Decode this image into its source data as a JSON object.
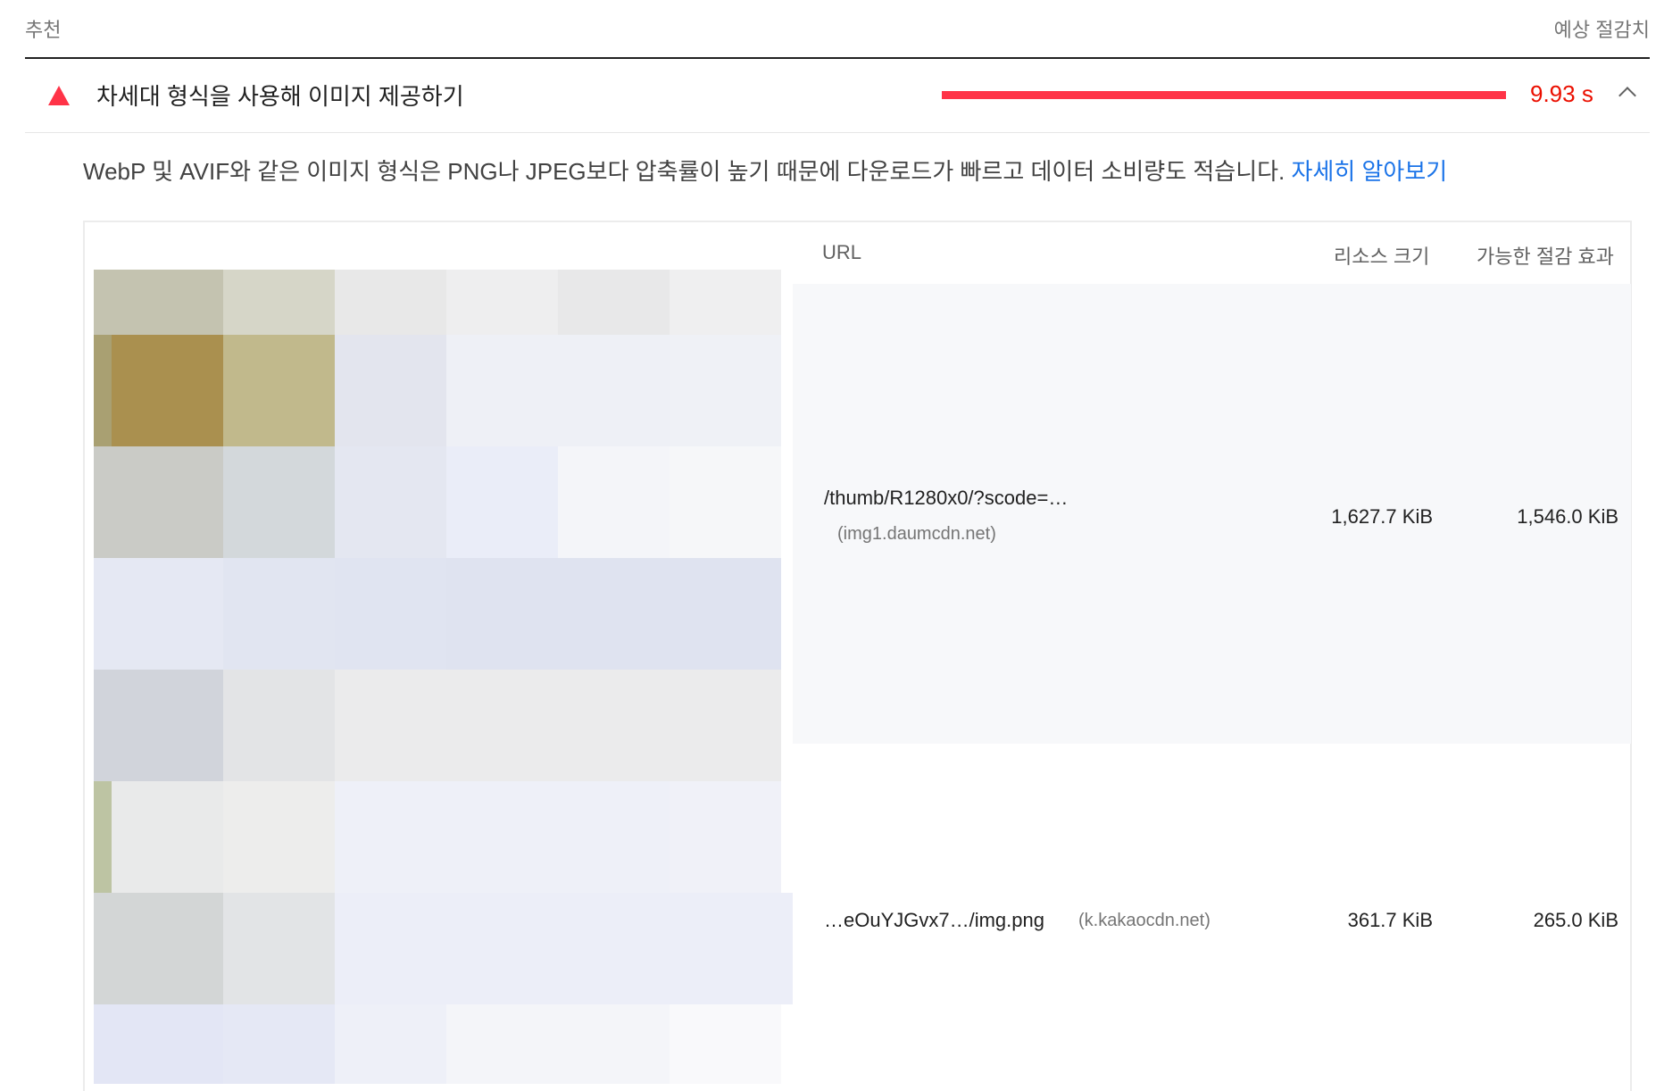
{
  "group": {
    "label": "추천",
    "savings_label": "예상 절감치"
  },
  "audit": {
    "title": "차세대 형식을 사용해 이미지 제공하기",
    "savings": "9.93 s",
    "status_color": "#ff3347",
    "icon": "warning-triangle-icon",
    "expanded": true
  },
  "description": {
    "text": "WebP 및 AVIF와 같은 이미지 형식은 PNG나 JPEG보다 압축률이 높기 때문에 다운로드가 빠르고 데이터 소비량도 적습니다. ",
    "link": "자세히 알아보기"
  },
  "table": {
    "columns": [
      "URL",
      "리소스 크기",
      "가능한 절감 효과"
    ],
    "rows": [
      {
        "url": "/thumb/R1280x0/?scode=…",
        "host": "(img1.daumcdn.net)",
        "size": "1,627.7 KiB",
        "savings": "1,546.0 KiB"
      },
      {
        "url": "…eOuYJGvx7…/img.png",
        "host": "(k.kakaocdn.net)",
        "size": "361.7 KiB",
        "savings": "265.0 KiB"
      }
    ]
  }
}
